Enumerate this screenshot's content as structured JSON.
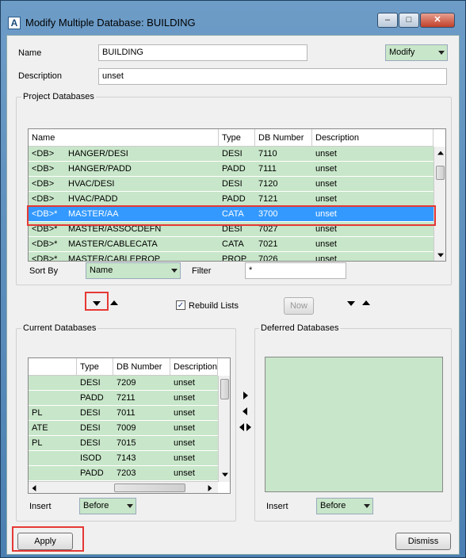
{
  "window": {
    "title": "Modify Multiple Database: BUILDING",
    "minimize": "–",
    "maximize": "□",
    "close": "✕"
  },
  "name_label": "Name",
  "name_value": "BUILDING",
  "mode_value": "Modify",
  "description_label": "Description",
  "description_value": "unset",
  "project_db": {
    "group_label": "Project Databases",
    "columns": [
      "Name",
      "Type",
      "DB Number",
      "Description"
    ],
    "rows": [
      {
        "prefix": "<DB>",
        "name": "HANGER/DESI",
        "type": "DESI",
        "number": "7110",
        "desc": "unset"
      },
      {
        "prefix": "<DB>",
        "name": "HANGER/PADD",
        "type": "PADD",
        "number": "7111",
        "desc": "unset"
      },
      {
        "prefix": "<DB>",
        "name": "HVAC/DESI",
        "type": "DESI",
        "number": "7120",
        "desc": "unset"
      },
      {
        "prefix": "<DB>",
        "name": "HVAC/PADD",
        "type": "PADD",
        "number": "7121",
        "desc": "unset"
      },
      {
        "prefix": "<DB>*",
        "name": "MASTER/AA",
        "type": "CATA",
        "number": "3700",
        "desc": "unset"
      },
      {
        "prefix": "<DB>*",
        "name": "MASTER/ASSOCDEFN",
        "type": "DESI",
        "number": "7027",
        "desc": "unset"
      },
      {
        "prefix": "<DB>*",
        "name": "MASTER/CABLECATA",
        "type": "CATA",
        "number": "7021",
        "desc": "unset"
      },
      {
        "prefix": "<DB>*",
        "name": "MASTER/CABLEPROP",
        "type": "PROP",
        "number": "7026",
        "desc": "unset"
      }
    ],
    "sort_label": "Sort By",
    "sort_value": "Name",
    "filter_label": "Filter",
    "filter_value": "*"
  },
  "rebuild_label": "Rebuild Lists",
  "rebuild_checked": "✓",
  "now_label": "Now",
  "current_db": {
    "group_label": "Current Databases",
    "columns": [
      "",
      "Type",
      "DB Number",
      "Description"
    ],
    "rows": [
      {
        "name": "",
        "type": "DESI",
        "number": "7209",
        "desc": "unset"
      },
      {
        "name": "",
        "type": "PADD",
        "number": "7211",
        "desc": "unset"
      },
      {
        "name": "PL",
        "type": "DESI",
        "number": "7011",
        "desc": "unset"
      },
      {
        "name": "ATE",
        "type": "DESI",
        "number": "7009",
        "desc": "unset"
      },
      {
        "name": "PL",
        "type": "DESI",
        "number": "7015",
        "desc": "unset"
      },
      {
        "name": "",
        "type": "ISOD",
        "number": "7143",
        "desc": "unset"
      },
      {
        "name": "",
        "type": "PADD",
        "number": "7203",
        "desc": "unset"
      }
    ],
    "insert_label": "Insert",
    "insert_value": "Before"
  },
  "deferred_db": {
    "group_label": "Deferred Databases",
    "insert_label": "Insert",
    "insert_value": "Before"
  },
  "apply_label": "Apply",
  "dismiss_label": "Dismiss",
  "colors": {
    "row_green": "#c8e6c9",
    "selected": "#3399ff",
    "highlight": "#e53935"
  }
}
